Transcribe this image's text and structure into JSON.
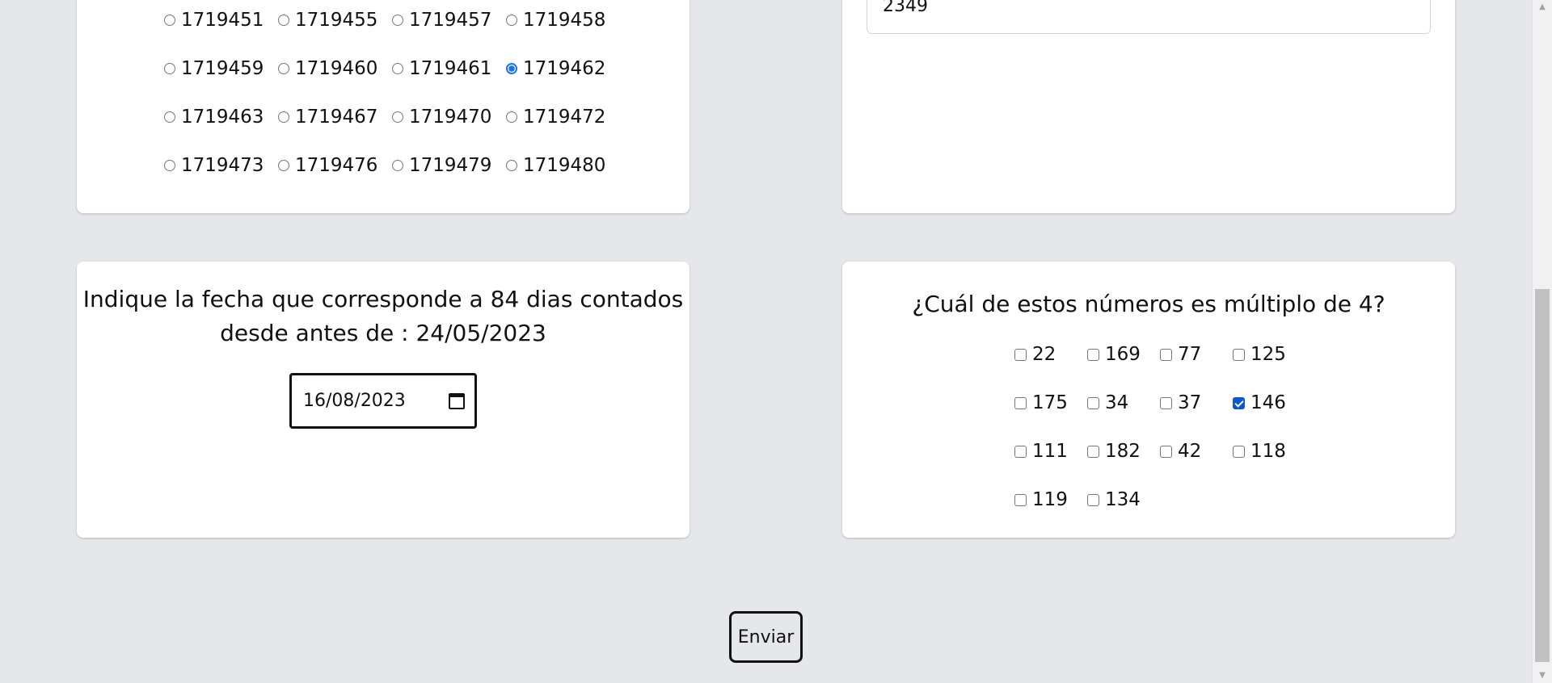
{
  "radio_question": {
    "options": [
      "1719451",
      "1719455",
      "1719457",
      "1719458",
      "1719459",
      "1719460",
      "1719461",
      "1719462",
      "1719463",
      "1719467",
      "1719470",
      "1719472",
      "1719473",
      "1719476",
      "1719479",
      "1719480"
    ],
    "selected": "1719462"
  },
  "number_answer": {
    "value": "2349"
  },
  "date_question": {
    "prompt": "Indique la fecha que corresponde a 84 dias contados desde antes de : 24/05/2023",
    "value": "16/08/2023",
    "icon": "calendar-icon"
  },
  "multiple_question": {
    "prompt": "¿Cuál de estos números es múltiplo de 4?",
    "options": [
      "22",
      "169",
      "77",
      "125",
      "175",
      "34",
      "37",
      "146",
      "111",
      "182",
      "42",
      "118",
      "119",
      "134"
    ],
    "checked": [
      "146"
    ]
  },
  "submit": {
    "label": "Enviar"
  },
  "colors": {
    "background": "#e5e7eb",
    "card": "#ffffff",
    "accent": "#1a73e8",
    "checkbox_checked": "#0b57d0"
  }
}
